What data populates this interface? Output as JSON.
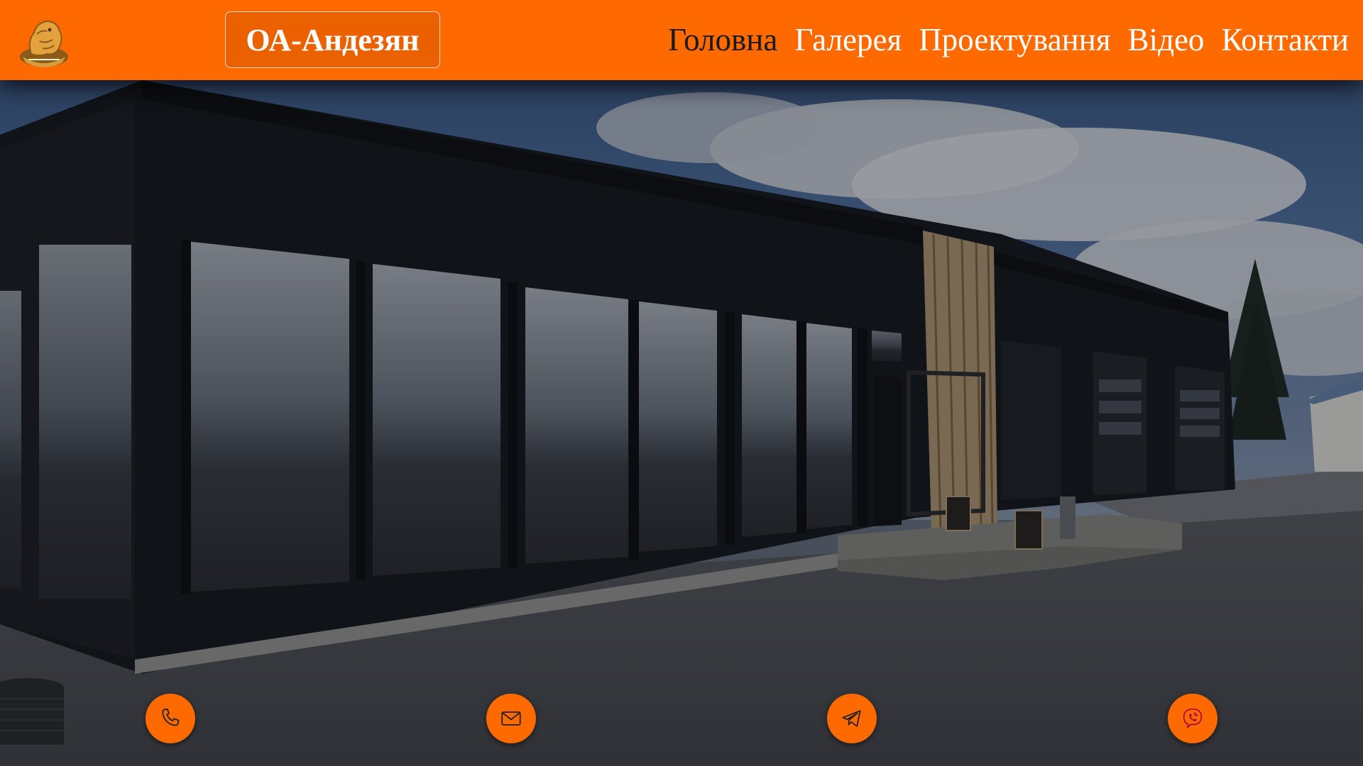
{
  "brand": {
    "name": "ОА-Андезян"
  },
  "nav": {
    "items": [
      {
        "label": "Головна",
        "active": true
      },
      {
        "label": "Галерея"
      },
      {
        "label": "Проектування"
      },
      {
        "label": "Відео"
      },
      {
        "label": "Контакти"
      }
    ]
  },
  "contacts": [
    {
      "icon": "phone-icon"
    },
    {
      "icon": "mail-icon"
    },
    {
      "icon": "telegram-icon"
    },
    {
      "icon": "viber-icon"
    }
  ],
  "colors": {
    "accent": "#ff6a00",
    "active_nav": "#1a1a1a",
    "nav_text": "#ffffff"
  }
}
